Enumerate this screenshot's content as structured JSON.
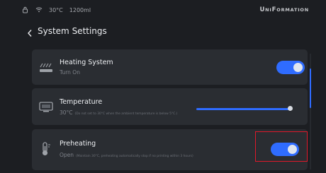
{
  "status": {
    "temperature": "30°C",
    "volume": "1200ml"
  },
  "brand": {
    "big1": "U",
    "small1": "NI",
    "big2": "F",
    "small2": "ORMATION"
  },
  "header": {
    "title": "System Settings"
  },
  "settings": [
    {
      "title": "Heating System",
      "subtitle": "Turn On",
      "note": "",
      "enabled": true
    },
    {
      "title": "Temperature",
      "subtitle": "30°C",
      "note": "(Do not set to 30°C when the ambient temperature is below 5°C.)",
      "slider_fraction": 1.0
    },
    {
      "title": "Preheating",
      "subtitle": "Open",
      "note": "(Maintain 30°C, preheating automatically stop if no printing within 3 hours)",
      "enabled": true
    }
  ],
  "colors": {
    "accent": "#2f6cff",
    "highlight": "#e0192a"
  },
  "scroll": {
    "position": 0.15
  }
}
